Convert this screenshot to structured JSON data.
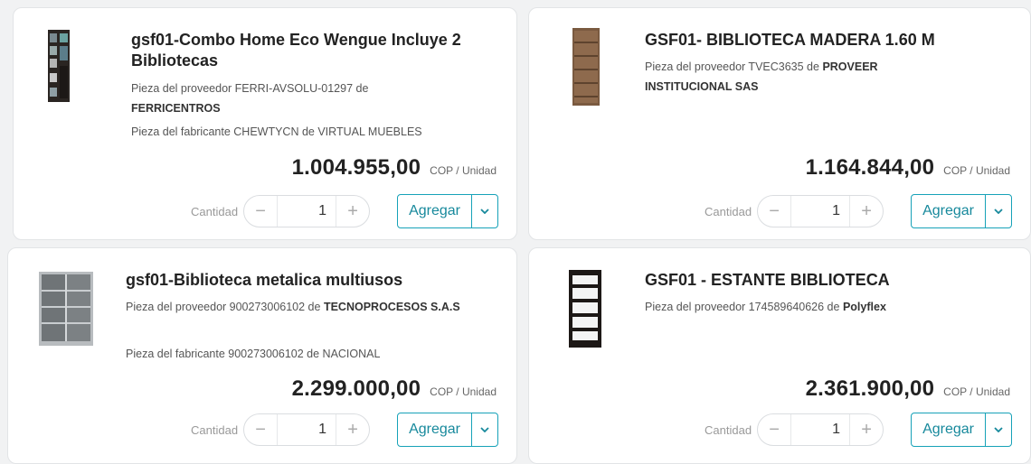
{
  "products": [
    {
      "title": "gsf01-Combo Home Eco Wengue Incluye 2 Bibliotecas",
      "supplier_prefix": "Pieza del proveedor FERRI-AVSOLU-01297 de",
      "supplier_name": "FERRICENTROS",
      "maker_line": "Pieza del fabricante CHEWTYCN de VIRTUAL MUEBLES",
      "price": "1.004.955,00",
      "unit": "COP / Unidad",
      "qty_label": "Cantidad",
      "qty": "1",
      "add_label": "Agregar"
    },
    {
      "title": "GSF01- BIBLIOTECA MADERA 1.60 M",
      "supplier_prefix": "Pieza del proveedor TVEC3635 de",
      "supplier_name": "PROVEER INSTITUCIONAL SAS",
      "maker_line": "",
      "price": "1.164.844,00",
      "unit": "COP / Unidad",
      "qty_label": "Cantidad",
      "qty": "1",
      "add_label": "Agregar"
    },
    {
      "title": "gsf01-Biblioteca metalica multiusos",
      "supplier_prefix": "Pieza del proveedor 900273006102 de",
      "supplier_name": "TECNOPROCESOS S.A.S",
      "maker_line": "Pieza del fabricante 900273006102 de NACIONAL",
      "price": "2.299.000,00",
      "unit": "COP / Unidad",
      "qty_label": "Cantidad",
      "qty": "1",
      "add_label": "Agregar"
    },
    {
      "title": "GSF01 - ESTANTE BIBLIOTECA",
      "supplier_prefix": "Pieza del proveedor 174589640626 de",
      "supplier_name": "Polyflex",
      "maker_line": "",
      "price": "2.361.900,00",
      "unit": "COP / Unidad",
      "qty_label": "Cantidad",
      "qty": "1",
      "add_label": "Agregar"
    }
  ],
  "icons": {
    "minus": "minus-icon",
    "plus": "plus-icon",
    "caret": "chevron-down-icon"
  },
  "colors": {
    "accent": "#17a2b8",
    "text": "#222222"
  }
}
